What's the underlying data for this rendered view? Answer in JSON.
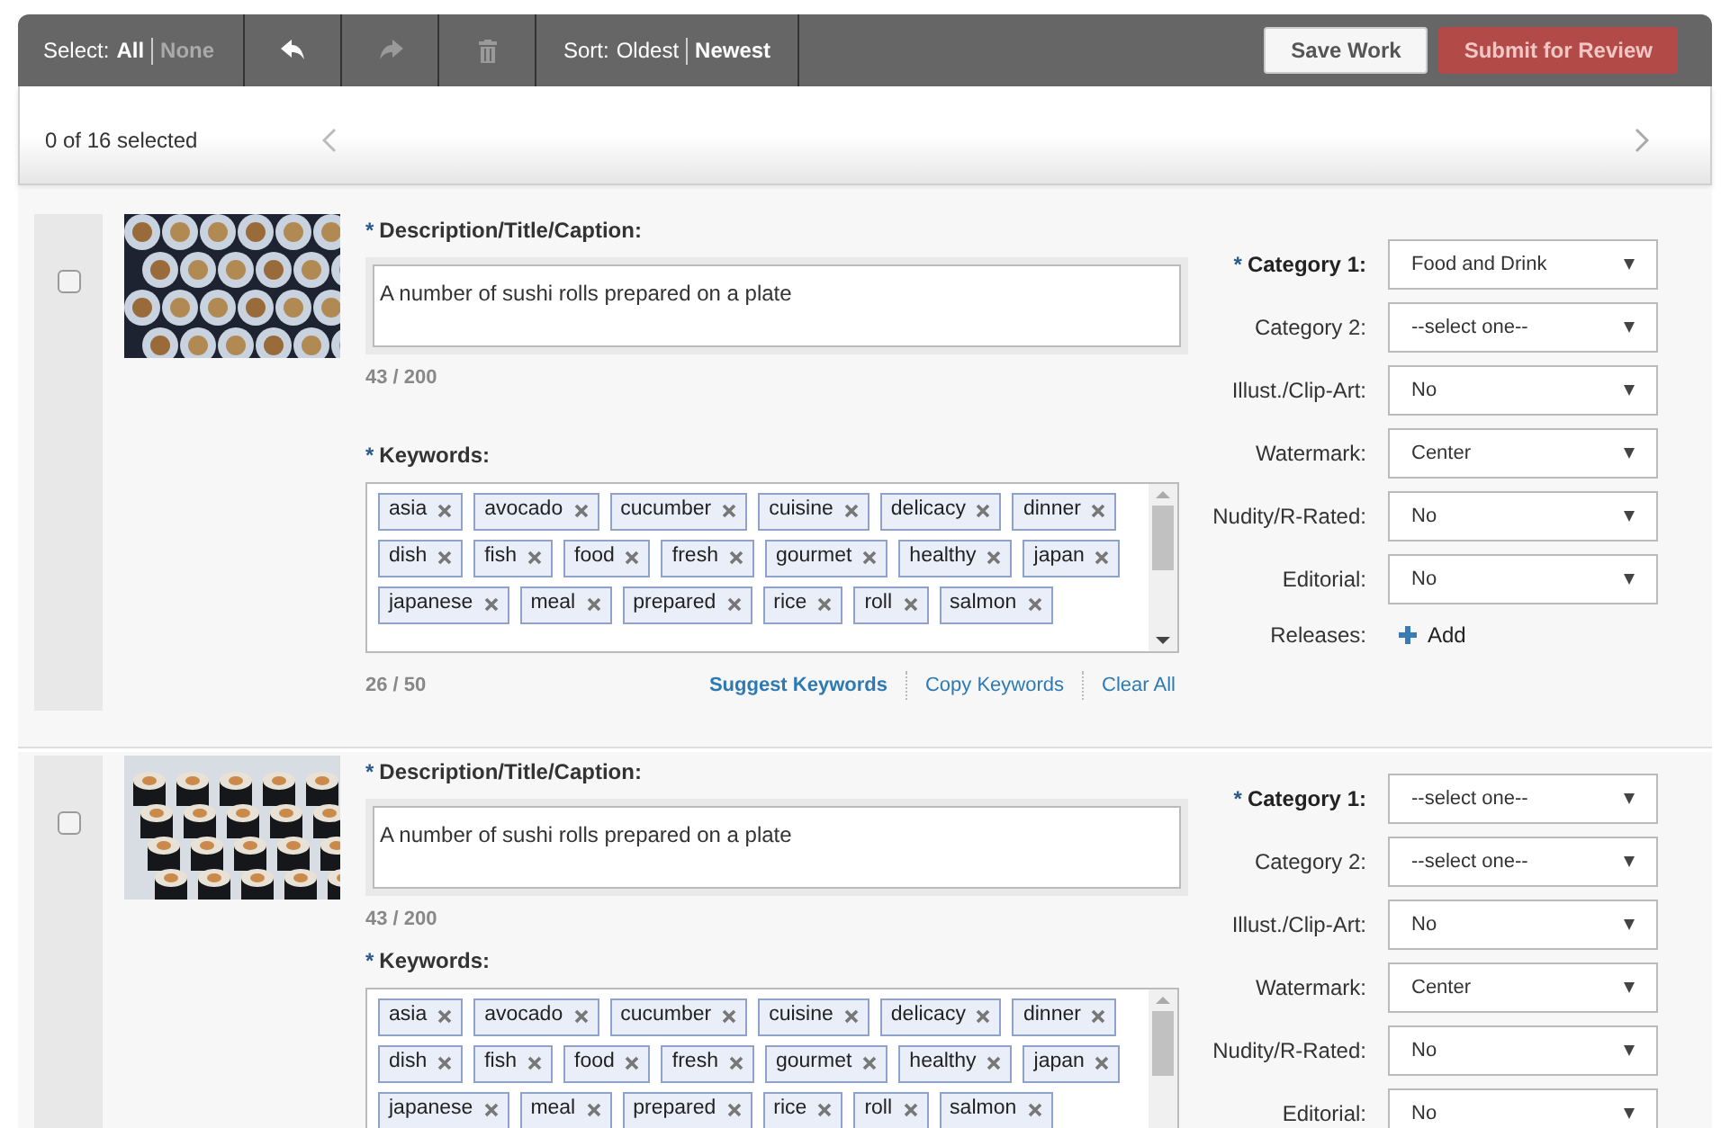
{
  "toolbar": {
    "select": {
      "label": "Select:",
      "options": [
        {
          "label": "All",
          "disabled": false
        },
        {
          "label": "None",
          "disabled": true
        }
      ]
    },
    "actions": [
      {
        "kind": "undo",
        "disabled": false
      },
      {
        "kind": "redo",
        "disabled": true
      },
      {
        "kind": "delete",
        "disabled": true
      }
    ],
    "sort": {
      "label": "Sort:",
      "options": [
        {
          "label": "Oldest",
          "selected": false
        },
        {
          "label": "Newest",
          "selected": true
        }
      ]
    },
    "buttons": [
      {
        "label": "Save Work",
        "kind": "secondary"
      },
      {
        "label": "Submit for Review",
        "kind": "primary"
      }
    ]
  },
  "selection_bar": {
    "count": "0 of 16 selected"
  },
  "items": [
    {
      "checked": false,
      "image": {
        "kind": "picture"
      },
      "description": {
        "label": "Description/Title/Caption:",
        "required_mark": "*",
        "value": "A number of sushi rolls prepared on a plate",
        "count": "43 / 200"
      },
      "keywords": {
        "label": "Keywords:",
        "required_mark": "*",
        "tags": [
          "asia",
          "avocado",
          "cucumber",
          "cuisine",
          "delicacy",
          "dinner",
          "dish",
          "fish",
          "food",
          "fresh",
          "gourmet",
          "healthy",
          "japan",
          "japanese",
          "meal",
          "prepared",
          "rice",
          "roll",
          "salmon"
        ],
        "count": "26 / 50",
        "links": [
          {
            "label": "Suggest Keywords",
            "primary": true
          },
          {
            "label": "Copy Keywords",
            "primary": false
          },
          {
            "label": "Clear All",
            "primary": false
          }
        ]
      },
      "fields": [
        {
          "kind": "select",
          "label": "Category 1:",
          "required_mark": "*",
          "value": "Food and Drink"
        },
        {
          "kind": "select",
          "label": "Category 2:",
          "value": "--select one--"
        },
        {
          "kind": "select",
          "label": "Illust./Clip-Art:",
          "value": "No"
        },
        {
          "kind": "select",
          "label": "Watermark:",
          "value": "Center"
        },
        {
          "kind": "select",
          "label": "Nudity/R-Rated:",
          "value": "No"
        },
        {
          "kind": "select",
          "label": "Editorial:",
          "value": "No"
        },
        {
          "kind": "add",
          "label": "Releases:",
          "value": "Add"
        }
      ]
    },
    {
      "checked": false,
      "image": {
        "kind": "picture"
      },
      "description": {
        "label": "Description/Title/Caption:",
        "required_mark": "*",
        "value": "A number of sushi rolls prepared on a plate",
        "count": "43 / 200"
      },
      "keywords": {
        "label": "Keywords:",
        "required_mark": "*",
        "tags": [
          "asia",
          "avocado",
          "cucumber",
          "cuisine",
          "delicacy",
          "dinner",
          "dish",
          "fish",
          "food",
          "fresh",
          "gourmet",
          "healthy",
          "japan",
          "japanese",
          "meal",
          "prepared",
          "rice",
          "roll",
          "salmon"
        ]
      },
      "fields": [
        {
          "kind": "select",
          "label": "Category 1:",
          "required_mark": "*",
          "value": "--select one--"
        },
        {
          "kind": "select",
          "label": "Category 2:",
          "value": "--select one--"
        },
        {
          "kind": "select",
          "label": "Illust./Clip-Art:",
          "value": "No"
        },
        {
          "kind": "select",
          "label": "Watermark:",
          "value": "Center"
        },
        {
          "kind": "select",
          "label": "Nudity/R-Rated:",
          "value": "No"
        },
        {
          "kind": "select",
          "label": "Editorial:",
          "value": "No"
        }
      ]
    }
  ]
}
